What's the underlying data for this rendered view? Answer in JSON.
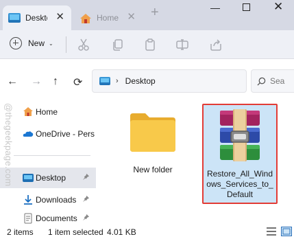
{
  "window": {
    "tabs": [
      {
        "label": "Desktop",
        "active": true,
        "close": "✕"
      },
      {
        "label": "Home",
        "active": false,
        "close": "✕"
      }
    ],
    "new_tab": "+",
    "controls": {
      "minimize": "—",
      "maximize": "",
      "close": "✕"
    }
  },
  "toolbar": {
    "new_label": "New",
    "new_chevron": "⌄",
    "icons": [
      "cut-icon",
      "copy-icon",
      "paste-icon",
      "rename-icon",
      "share-icon"
    ]
  },
  "navigation": {
    "back": "←",
    "forward": "→",
    "up": "↑",
    "refresh": "⟳",
    "breadcrumb_separator": "›",
    "breadcrumb": [
      "Desktop"
    ],
    "search_placeholder": "Sea"
  },
  "sidebar": {
    "items": [
      {
        "label": "Home",
        "icon": "home-icon",
        "pinned": false
      },
      {
        "label": "OneDrive - Personal",
        "icon": "onedrive-icon",
        "pinned": false
      },
      {
        "label": "Desktop",
        "icon": "desktop-icon",
        "pinned": true,
        "selected": true
      },
      {
        "label": "Downloads",
        "icon": "download-icon",
        "pinned": true
      },
      {
        "label": "Documents",
        "icon": "documents-icon",
        "pinned": true
      }
    ],
    "pin_glyph": "📌"
  },
  "watermark": "@thegeekpage.com",
  "files": [
    {
      "name": "New folder",
      "type": "folder"
    },
    {
      "name": "Restore_All_Windows_Services_to_Default",
      "type": "winrar-archive",
      "selected": true,
      "name_lines": [
        "Restore_All_Wind",
        "ows_Services_to_",
        "Default"
      ]
    }
  ],
  "status": {
    "item_count": "2 items",
    "selection": "1 item selected",
    "size": "4.01 KB"
  },
  "colors": {
    "titlebar": "#d6d9e4",
    "toolbar": "#eef0f6",
    "selection_fill": "#cce4f7",
    "highlight_border": "#e23b35",
    "folder": "#f8c94a"
  }
}
